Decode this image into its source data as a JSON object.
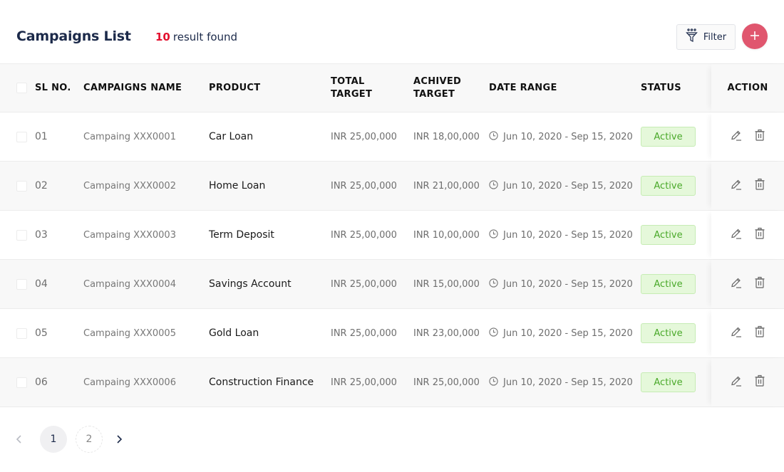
{
  "header": {
    "title": "Campaigns List",
    "result_count": "10",
    "result_label": "result found",
    "filter_label": "Filter",
    "add_button_icon": "plus-icon",
    "accent_color": "#e0566e",
    "count_color": "#e3112f"
  },
  "table": {
    "columns": {
      "sl_no": "SL NO.",
      "campaign_name": "CAMPAIGNS NAME",
      "product": "PRODUCT",
      "total_target_1": "TOTAL",
      "total_target_2": "TARGET",
      "achieved_target_1": "ACHIVED",
      "achieved_target_2": "TARGET",
      "date_range": "DATE RANGE",
      "status": "STATUS",
      "action": "ACTION"
    },
    "rows": [
      {
        "sl": "01",
        "name": "Campaing XXX0001",
        "product": "Car Loan",
        "total": "INR 25,00,000",
        "achieved": "INR 18,00,000",
        "date": "Jun 10, 2020 - Sep 15, 2020",
        "status": "Active"
      },
      {
        "sl": "02",
        "name": "Campaing XXX0002",
        "product": "Home Loan",
        "total": "INR 25,00,000",
        "achieved": "INR 21,00,000",
        "date": "Jun 10, 2020 - Sep 15, 2020",
        "status": "Active"
      },
      {
        "sl": "03",
        "name": "Campaing XXX0003",
        "product": "Term Deposit",
        "total": "INR 25,00,000",
        "achieved": "INR 10,00,000",
        "date": "Jun 10, 2020 - Sep 15, 2020",
        "status": "Active"
      },
      {
        "sl": "04",
        "name": "Campaing XXX0004",
        "product": "Savings Account",
        "total": "INR 25,00,000",
        "achieved": "INR 15,00,000",
        "date": "Jun 10, 2020 - Sep 15, 2020",
        "status": "Active"
      },
      {
        "sl": "05",
        "name": "Campaing XXX0005",
        "product": "Gold Loan",
        "total": "INR 25,00,000",
        "achieved": "INR 23,00,000",
        "date": "Jun 10, 2020 - Sep 15, 2020",
        "status": "Active"
      },
      {
        "sl": "06",
        "name": "Campaing XXX0006",
        "product": "Construction Finance",
        "total": "INR 25,00,000",
        "achieved": "INR 25,00,000",
        "date": "Jun 10, 2020 - Sep 15, 2020",
        "status": "Active"
      }
    ],
    "status_colors": {
      "text": "#4aa92a",
      "background": "#e5f8da",
      "border": "#c6ecb4"
    }
  },
  "pagination": {
    "pages": [
      "1",
      "2"
    ],
    "current": "1",
    "prev_icon": "chevron-left-icon",
    "next_icon": "chevron-right-icon"
  }
}
